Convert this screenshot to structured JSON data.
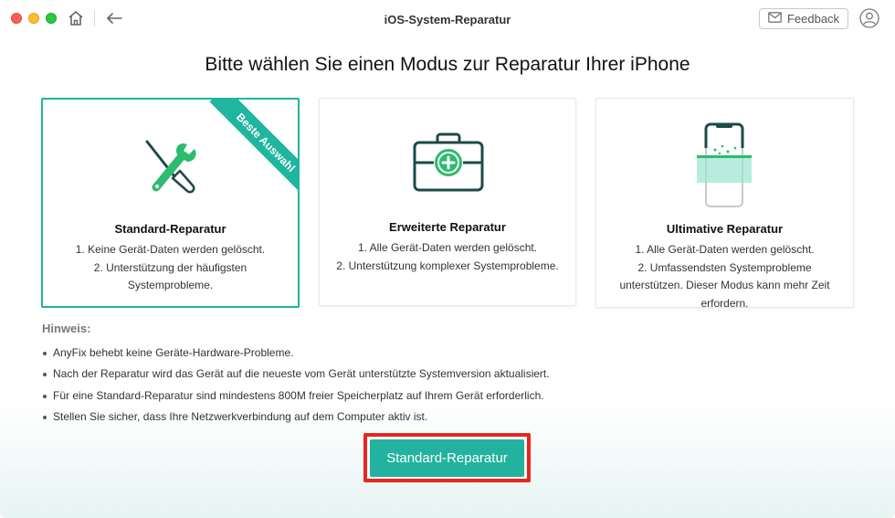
{
  "window": {
    "title": "iOS-System-Reparatur",
    "feedback_label": "Feedback"
  },
  "heading": "Bitte wählen Sie einen Modus zur Reparatur Ihrer iPhone",
  "modes": [
    {
      "title": "Standard-Reparatur",
      "badge": "Beste Auswahl",
      "selected": true,
      "icon": "wrench-screwdriver-icon",
      "desc": [
        "1. Keine Gerät-Daten werden gelöscht.",
        "2. Unterstützung der häufigsten",
        "Systemprobleme."
      ]
    },
    {
      "title": "Erweiterte Reparatur",
      "selected": false,
      "icon": "toolbox-icon",
      "desc": [
        "1. Alle Gerät-Daten werden gelöscht.",
        "2. Unterstützung komplexer Systemprobleme."
      ]
    },
    {
      "title": "Ultimative Reparatur",
      "selected": false,
      "icon": "phone-scan-icon",
      "desc": [
        "1. Alle Gerät-Daten werden gelöscht.",
        "2. Umfassendsten Systemprobleme",
        "unterstützen. Dieser Modus kann mehr Zeit",
        "erfordern."
      ]
    }
  ],
  "notes": {
    "title": "Hinweis:",
    "items": [
      "AnyFix behebt keine Geräte-Hardware-Probleme.",
      "Nach der Reparatur wird das Gerät auf die neueste vom Gerät unterstützte Systemversion aktualisiert.",
      "Für eine Standard-Reparatur sind mindestens 800M freier Speicherplatz auf Ihrem Gerät erforderlich.",
      "Stellen Sie sicher, dass Ihre Netzwerkverbindung auf dem Computer aktiv ist."
    ]
  },
  "primary_button": "Standard-Reparatur",
  "colors": {
    "accent": "#1fb59f",
    "highlight_border": "#e8261e"
  }
}
